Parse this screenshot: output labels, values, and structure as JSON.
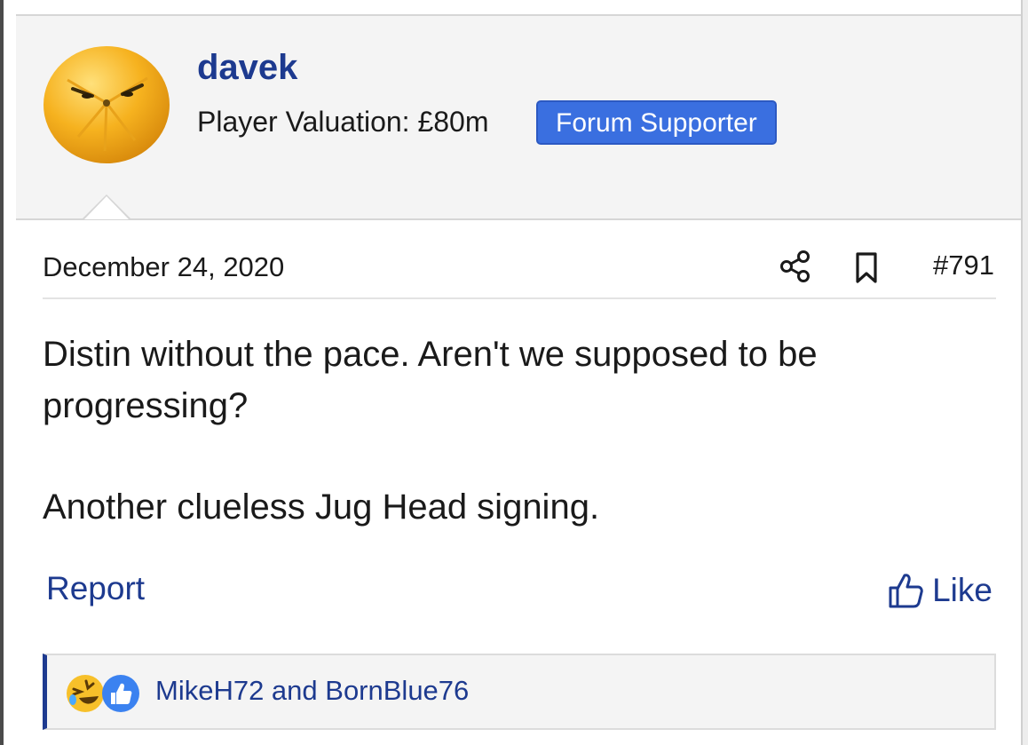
{
  "post": {
    "author": {
      "username": "davek",
      "valuation": "Player Valuation: £80m",
      "badge": "Forum Supporter"
    },
    "date": "December 24, 2020",
    "number": "#791",
    "message": [
      "Distin without the pace. Aren't we supposed to be progressing?",
      "Another clueless Jug Head signing."
    ],
    "actions": {
      "report": "Report",
      "like": "Like"
    },
    "reactions": {
      "users": "MikeH72 and BornBlue76",
      "icons": [
        "laughing-emoji",
        "like-thumb"
      ]
    }
  },
  "colors": {
    "link": "#1d3a8f",
    "badge": "#3a6fe0",
    "header_bg": "#f4f4f4"
  }
}
